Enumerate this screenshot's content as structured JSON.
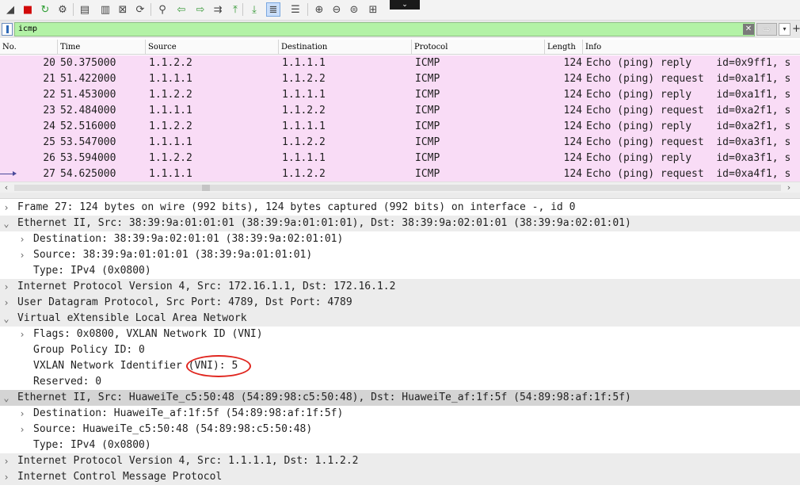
{
  "toolbar": {
    "buttons": [
      {
        "icon": "shark-fin-start-icon",
        "glyph": "◢"
      },
      {
        "icon": "stop-capture-icon",
        "glyph": "■",
        "color": "#d20a0a"
      },
      {
        "icon": "restart-capture-icon",
        "glyph": "↻",
        "color": "#2e9e33"
      },
      {
        "icon": "capture-options-icon",
        "glyph": "⚙"
      },
      {
        "icon": "open-file-icon",
        "glyph": "▤"
      },
      {
        "icon": "save-file-icon",
        "glyph": "▥"
      },
      {
        "icon": "close-file-icon",
        "glyph": "⊠"
      },
      {
        "icon": "reload-file-icon",
        "glyph": "⟳"
      },
      {
        "icon": "find-packet-icon",
        "glyph": "⚲"
      },
      {
        "icon": "go-back-icon",
        "glyph": "⇦",
        "color": "#3a9a3a"
      },
      {
        "icon": "go-forward-icon",
        "glyph": "⇨",
        "color": "#3a9a3a"
      },
      {
        "icon": "go-to-packet-icon",
        "glyph": "⇉"
      },
      {
        "icon": "first-packet-icon",
        "glyph": "⤒",
        "color": "#3a9a3a"
      },
      {
        "icon": "last-packet-icon",
        "glyph": "⤓",
        "color": "#3a9a3a"
      },
      {
        "icon": "auto-scroll-icon",
        "glyph": "≣",
        "active": true
      },
      {
        "icon": "colorize-icon",
        "glyph": "☰"
      },
      {
        "icon": "zoom-in-icon",
        "glyph": "⊕"
      },
      {
        "icon": "zoom-out-icon",
        "glyph": "⊖"
      },
      {
        "icon": "zoom-normal-icon",
        "glyph": "⊜"
      },
      {
        "icon": "resize-columns-icon",
        "glyph": "⊞"
      }
    ],
    "more_glyph": "⌄"
  },
  "filter": {
    "value": "icmp",
    "clear_glyph": "✕",
    "apply_glyph": "⇨",
    "dropdown_glyph": "▾",
    "add_glyph": "+"
  },
  "packet_list": {
    "columns": [
      "No.",
      "Time",
      "Source",
      "Destination",
      "Protocol",
      "Length",
      "Info"
    ],
    "rows": [
      {
        "no": "20",
        "time": "50.375000",
        "src": "1.1.2.2",
        "dst": "1.1.1.1",
        "proto": "ICMP",
        "len": "124",
        "info": "Echo (ping) reply    id=0x9ff1, s"
      },
      {
        "no": "21",
        "time": "51.422000",
        "src": "1.1.1.1",
        "dst": "1.1.2.2",
        "proto": "ICMP",
        "len": "124",
        "info": "Echo (ping) request  id=0xa1f1, s"
      },
      {
        "no": "22",
        "time": "51.453000",
        "src": "1.1.2.2",
        "dst": "1.1.1.1",
        "proto": "ICMP",
        "len": "124",
        "info": "Echo (ping) reply    id=0xa1f1, s"
      },
      {
        "no": "23",
        "time": "52.484000",
        "src": "1.1.1.1",
        "dst": "1.1.2.2",
        "proto": "ICMP",
        "len": "124",
        "info": "Echo (ping) request  id=0xa2f1, s"
      },
      {
        "no": "24",
        "time": "52.516000",
        "src": "1.1.2.2",
        "dst": "1.1.1.1",
        "proto": "ICMP",
        "len": "124",
        "info": "Echo (ping) reply    id=0xa2f1, s"
      },
      {
        "no": "25",
        "time": "53.547000",
        "src": "1.1.1.1",
        "dst": "1.1.2.2",
        "proto": "ICMP",
        "len": "124",
        "info": "Echo (ping) request  id=0xa3f1, s"
      },
      {
        "no": "26",
        "time": "53.594000",
        "src": "1.1.2.2",
        "dst": "1.1.1.1",
        "proto": "ICMP",
        "len": "124",
        "info": "Echo (ping) reply    id=0xa3f1, s"
      },
      {
        "no": "27",
        "time": "54.625000",
        "src": "1.1.1.1",
        "dst": "1.1.2.2",
        "proto": "ICMP",
        "len": "124",
        "info": "Echo (ping) request  id=0xa4f1, s"
      }
    ],
    "row_color": "#f9dcf6"
  },
  "scrollbar": {
    "left_glyph": "‹",
    "right_glyph": "›"
  },
  "details": {
    "rows": [
      {
        "level": 0,
        "toggle": "›",
        "text": "Frame 27: 124 bytes on wire (992 bits), 124 bytes captured (992 bits) on interface -, id 0",
        "style": "plain"
      },
      {
        "level": 0,
        "toggle": "⌄",
        "text": "Ethernet II, Src: 38:39:9a:01:01:01 (38:39:9a:01:01:01), Dst: 38:39:9a:02:01:01 (38:39:9a:02:01:01)",
        "style": "shaded"
      },
      {
        "level": 1,
        "toggle": "›",
        "text": "Destination: 38:39:9a:02:01:01 (38:39:9a:02:01:01)",
        "style": "plain"
      },
      {
        "level": 1,
        "toggle": "›",
        "text": "Source: 38:39:9a:01:01:01 (38:39:9a:01:01:01)",
        "style": "plain"
      },
      {
        "level": 1,
        "toggle": "",
        "text": "Type: IPv4 (0x0800)",
        "style": "plain"
      },
      {
        "level": 0,
        "toggle": "›",
        "text": "Internet Protocol Version 4, Src: 172.16.1.1, Dst: 172.16.1.2",
        "style": "shaded"
      },
      {
        "level": 0,
        "toggle": "›",
        "text": "User Datagram Protocol, Src Port: 4789, Dst Port: 4789",
        "style": "shaded"
      },
      {
        "level": 0,
        "toggle": "⌄",
        "text": "Virtual eXtensible Local Area Network",
        "style": "shaded"
      },
      {
        "level": 1,
        "toggle": "›",
        "text": "Flags: 0x0800, VXLAN Network ID (VNI)",
        "style": "plain"
      },
      {
        "level": 1,
        "toggle": "",
        "text": "Group Policy ID: 0",
        "style": "plain"
      },
      {
        "level": 1,
        "toggle": "",
        "text": "VXLAN Network Identifier (VNI): 5",
        "style": "plain"
      },
      {
        "level": 1,
        "toggle": "",
        "text": "Reserved: 0",
        "style": "plain"
      },
      {
        "level": 0,
        "toggle": "⌄",
        "text": "Ethernet II, Src: HuaweiTe_c5:50:48 (54:89:98:c5:50:48), Dst: HuaweiTe_af:1f:5f (54:89:98:af:1f:5f)",
        "style": "selected"
      },
      {
        "level": 1,
        "toggle": "›",
        "text": "Destination: HuaweiTe_af:1f:5f (54:89:98:af:1f:5f)",
        "style": "plain"
      },
      {
        "level": 1,
        "toggle": "›",
        "text": "Source: HuaweiTe_c5:50:48 (54:89:98:c5:50:48)",
        "style": "plain"
      },
      {
        "level": 1,
        "toggle": "",
        "text": "Type: IPv4 (0x0800)",
        "style": "plain"
      },
      {
        "level": 0,
        "toggle": "›",
        "text": "Internet Protocol Version 4, Src: 1.1.1.1, Dst: 1.1.2.2",
        "style": "shaded"
      },
      {
        "level": 0,
        "toggle": "›",
        "text": "Internet Control Message Protocol",
        "style": "shaded"
      }
    ],
    "highlight_color": "#e0261f"
  }
}
